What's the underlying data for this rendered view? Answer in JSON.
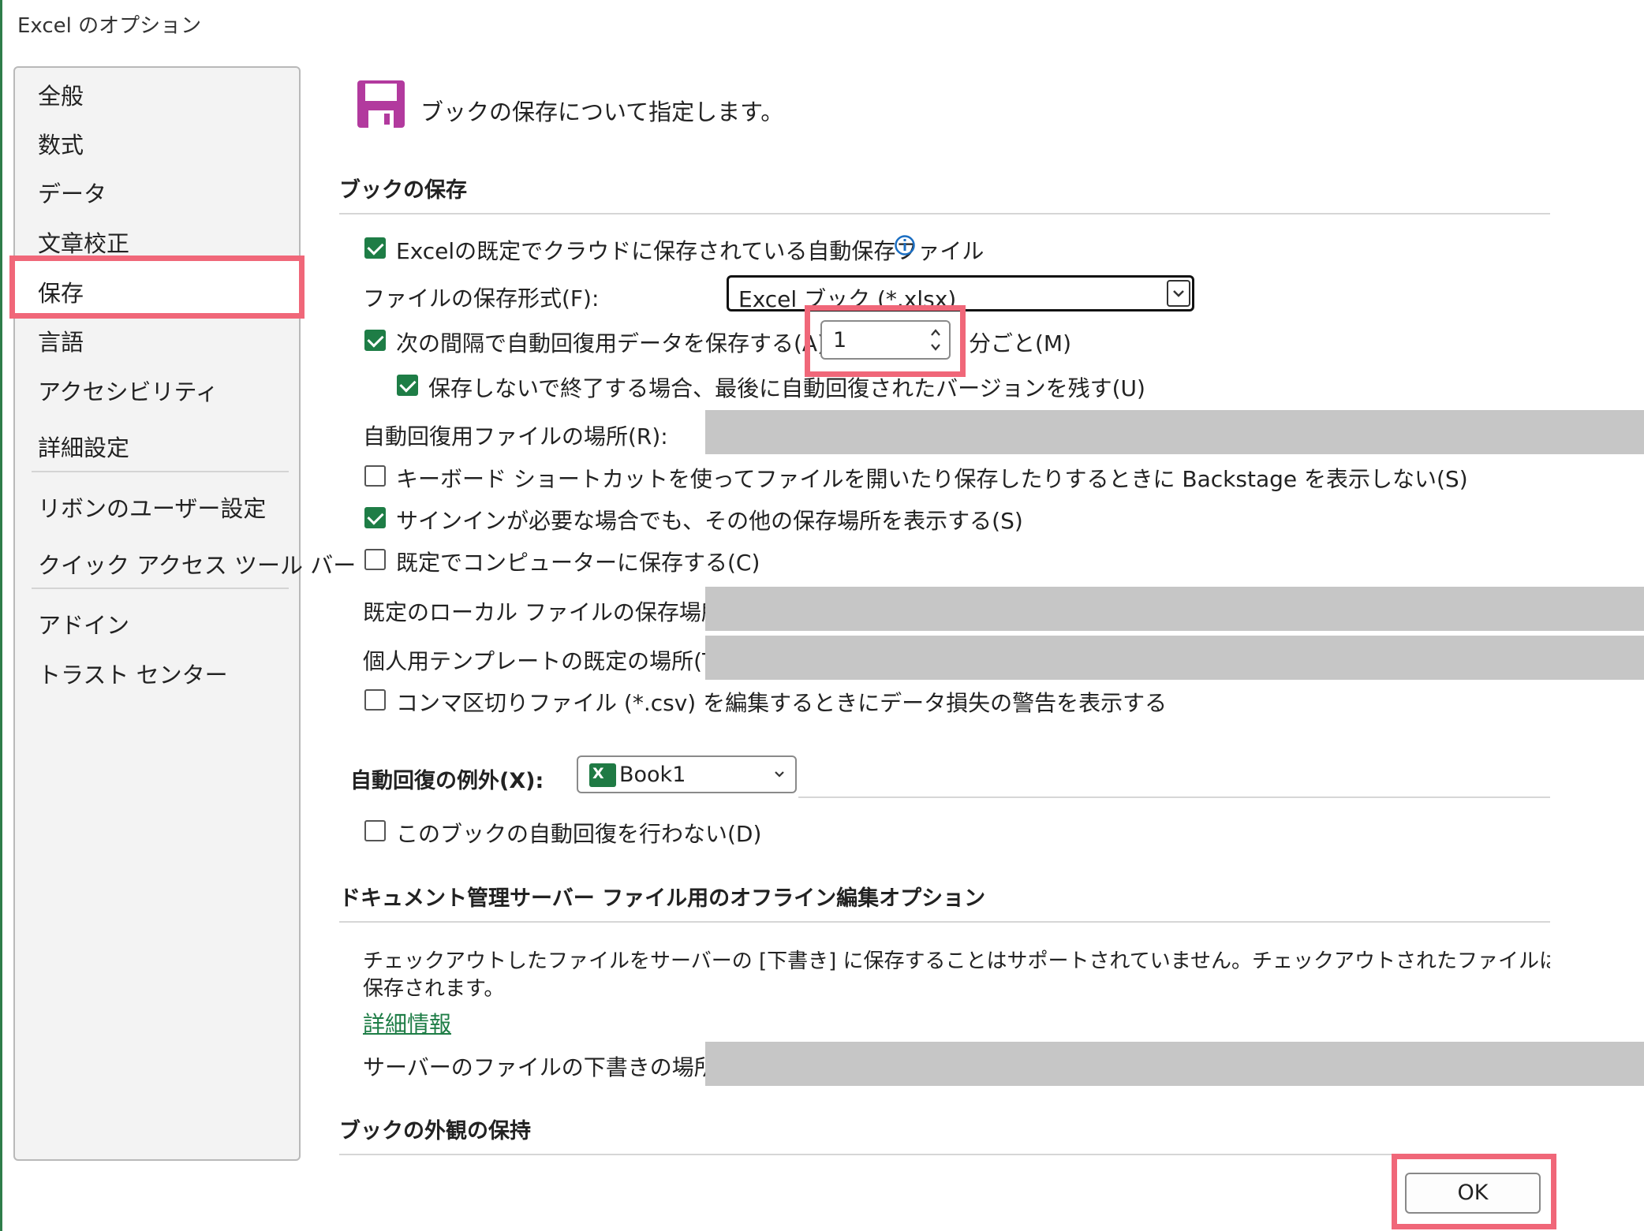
{
  "window": {
    "title": "Excel のオプション",
    "accent_color": "#1e7d46",
    "highlight_color": "#f06779"
  },
  "sidebar": {
    "items": [
      {
        "label": "全般"
      },
      {
        "label": "数式"
      },
      {
        "label": "データ"
      },
      {
        "label": "文章校正"
      },
      {
        "label": "保存",
        "selected": true
      },
      {
        "label": "言語"
      },
      {
        "label": "アクセシビリティ"
      },
      {
        "label": "詳細設定"
      },
      {
        "label": "リボンのユーザー設定"
      },
      {
        "label": "クイック アクセス ツール バー"
      },
      {
        "label": "アドイン"
      },
      {
        "label": "トラスト センター"
      }
    ]
  },
  "header": {
    "icon": "save-icon",
    "text": "ブックの保存について指定します。"
  },
  "save_section": {
    "title": "ブックの保存",
    "cloud_autosave": {
      "label": "Excelの既定でクラウドに保存されている自動保存ファイル",
      "checked": true,
      "info_icon": "info-icon"
    },
    "file_format": {
      "label": "ファイルの保存形式(F):",
      "value": "Excel ブック (*.xlsx)"
    },
    "autorecover": {
      "label": "次の間隔で自動回復用データを保存する(A):",
      "checked": true,
      "minutes_value": "1",
      "minutes_suffix": "分ごと(M)"
    },
    "keep_last": {
      "label": "保存しないで終了する場合、最後に自動回復されたバージョンを残す(U)",
      "checked": true
    },
    "autorecover_location": {
      "label": "自動回復用ファイルの場所(R):",
      "value": ""
    },
    "no_backstage": {
      "label": "キーボード ショートカットを使ってファイルを開いたり保存したりするときに Backstage を表示しない(S)",
      "checked": false
    },
    "show_other_locations": {
      "label": "サインインが必要な場合でも、その他の保存場所を表示する(S)",
      "checked": true
    },
    "save_to_computer": {
      "label": "既定でコンピューターに保存する(C)",
      "checked": false
    },
    "default_local_location": {
      "label": "既定のローカル ファイルの保存場所(I):",
      "value": ""
    },
    "personal_templates": {
      "label": "個人用テンプレートの既定の場所(T):",
      "value": ""
    },
    "csv_warning": {
      "label": "コンマ区切りファイル (*.csv) を編集するときにデータ損失の警告を表示する",
      "checked": false
    }
  },
  "autorecover_exceptions": {
    "label": "自動回復の例外(X):",
    "workbook": "Book1",
    "disable": {
      "label": "このブックの自動回復を行わない(D)",
      "checked": false
    }
  },
  "offline_section": {
    "title": "ドキュメント管理サーバー ファイル用のオフライン編集オプション",
    "description_line1": "チェックアウトしたファイルをサーバーの [下書き] に保存することはサポートされていません。チェックアウトされたファイルは Office ドキュメント キャ",
    "description_line2": "保存されます。",
    "more_info_link": "詳細情報",
    "drafts_location": {
      "label": "サーバーのファイルの下書きの場所(V):",
      "value": ""
    }
  },
  "appearance_section": {
    "title": "ブックの外観の保持"
  },
  "buttons": {
    "ok": "OK"
  }
}
